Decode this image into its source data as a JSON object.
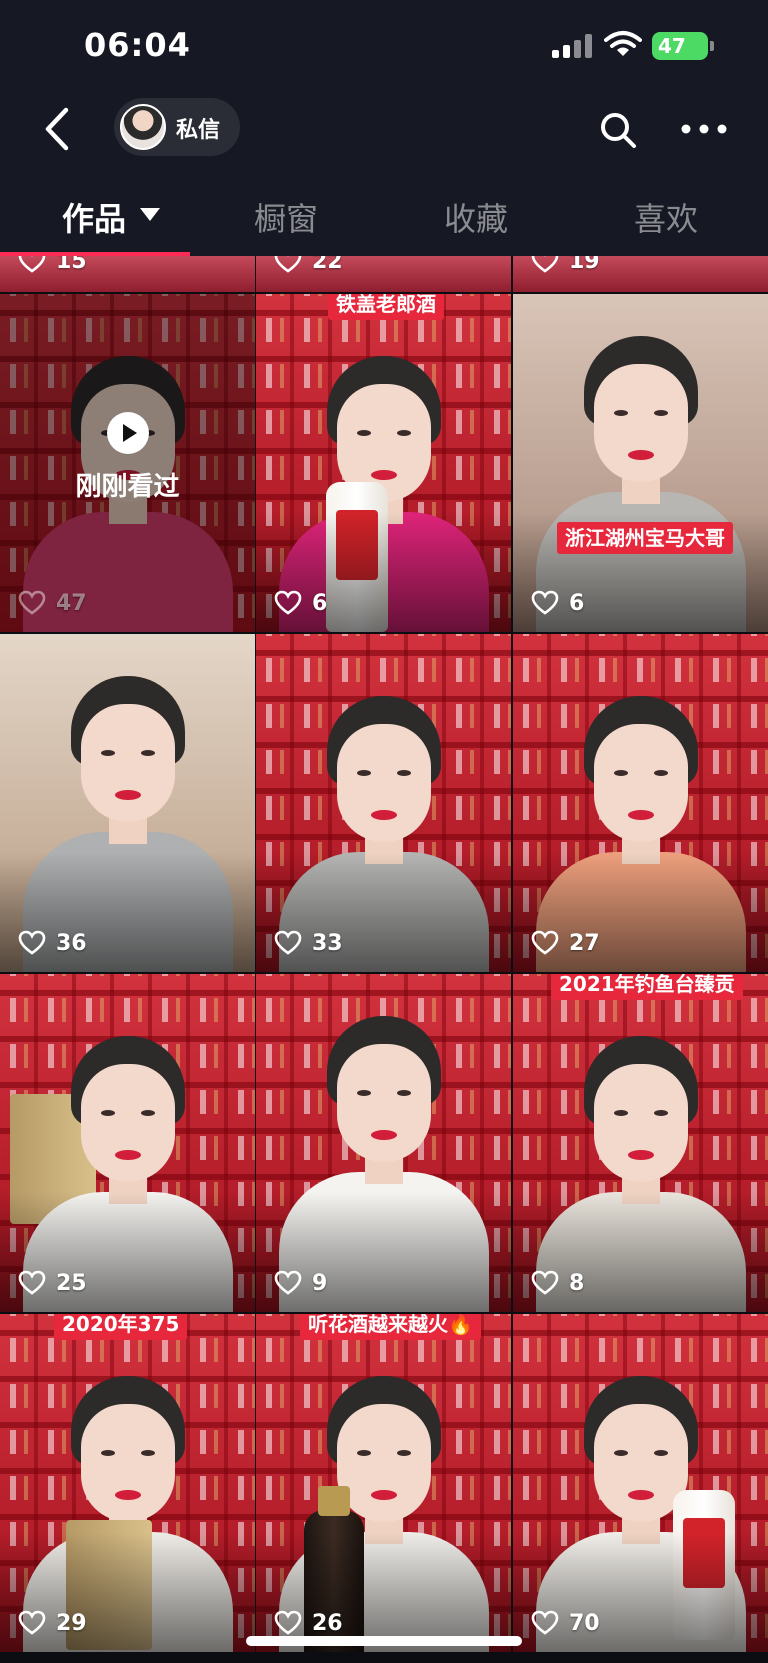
{
  "status_bar": {
    "time": "06:04",
    "battery": "47"
  },
  "header": {
    "dm_label": "私信"
  },
  "tabs": [
    {
      "label": "作品",
      "active": true
    },
    {
      "label": "橱窗"
    },
    {
      "label": "收藏"
    },
    {
      "label": "喜欢"
    }
  ],
  "partial_row": [
    {
      "likes": "15"
    },
    {
      "likes": "22"
    },
    {
      "likes": "19"
    }
  ],
  "videos": [
    {
      "likes": "47",
      "caption": "",
      "watched": true,
      "watched_label": "刚刚看过"
    },
    {
      "likes": "6",
      "caption": "铁盖老郎酒"
    },
    {
      "likes": "6",
      "caption": "浙江湖州宝马大哥"
    },
    {
      "likes": "36",
      "caption": ""
    },
    {
      "likes": "33",
      "caption": ""
    },
    {
      "likes": "27",
      "caption": ""
    },
    {
      "likes": "25",
      "caption": ""
    },
    {
      "likes": "9",
      "caption": ""
    },
    {
      "likes": "8",
      "caption": "2021年钓鱼台臻贡"
    },
    {
      "likes": "29",
      "caption": "2020年375"
    },
    {
      "likes": "26",
      "caption": "听花酒越来越火🔥"
    },
    {
      "likes": "70",
      "caption": ""
    }
  ],
  "colors": {
    "accent": "#fe2c55",
    "caption_bg": "#e7283c",
    "background": "#161823"
  },
  "icons": [
    "back-arrow-icon",
    "search-icon",
    "more-icon",
    "heart-icon",
    "play-icon",
    "caret-down-icon"
  ]
}
